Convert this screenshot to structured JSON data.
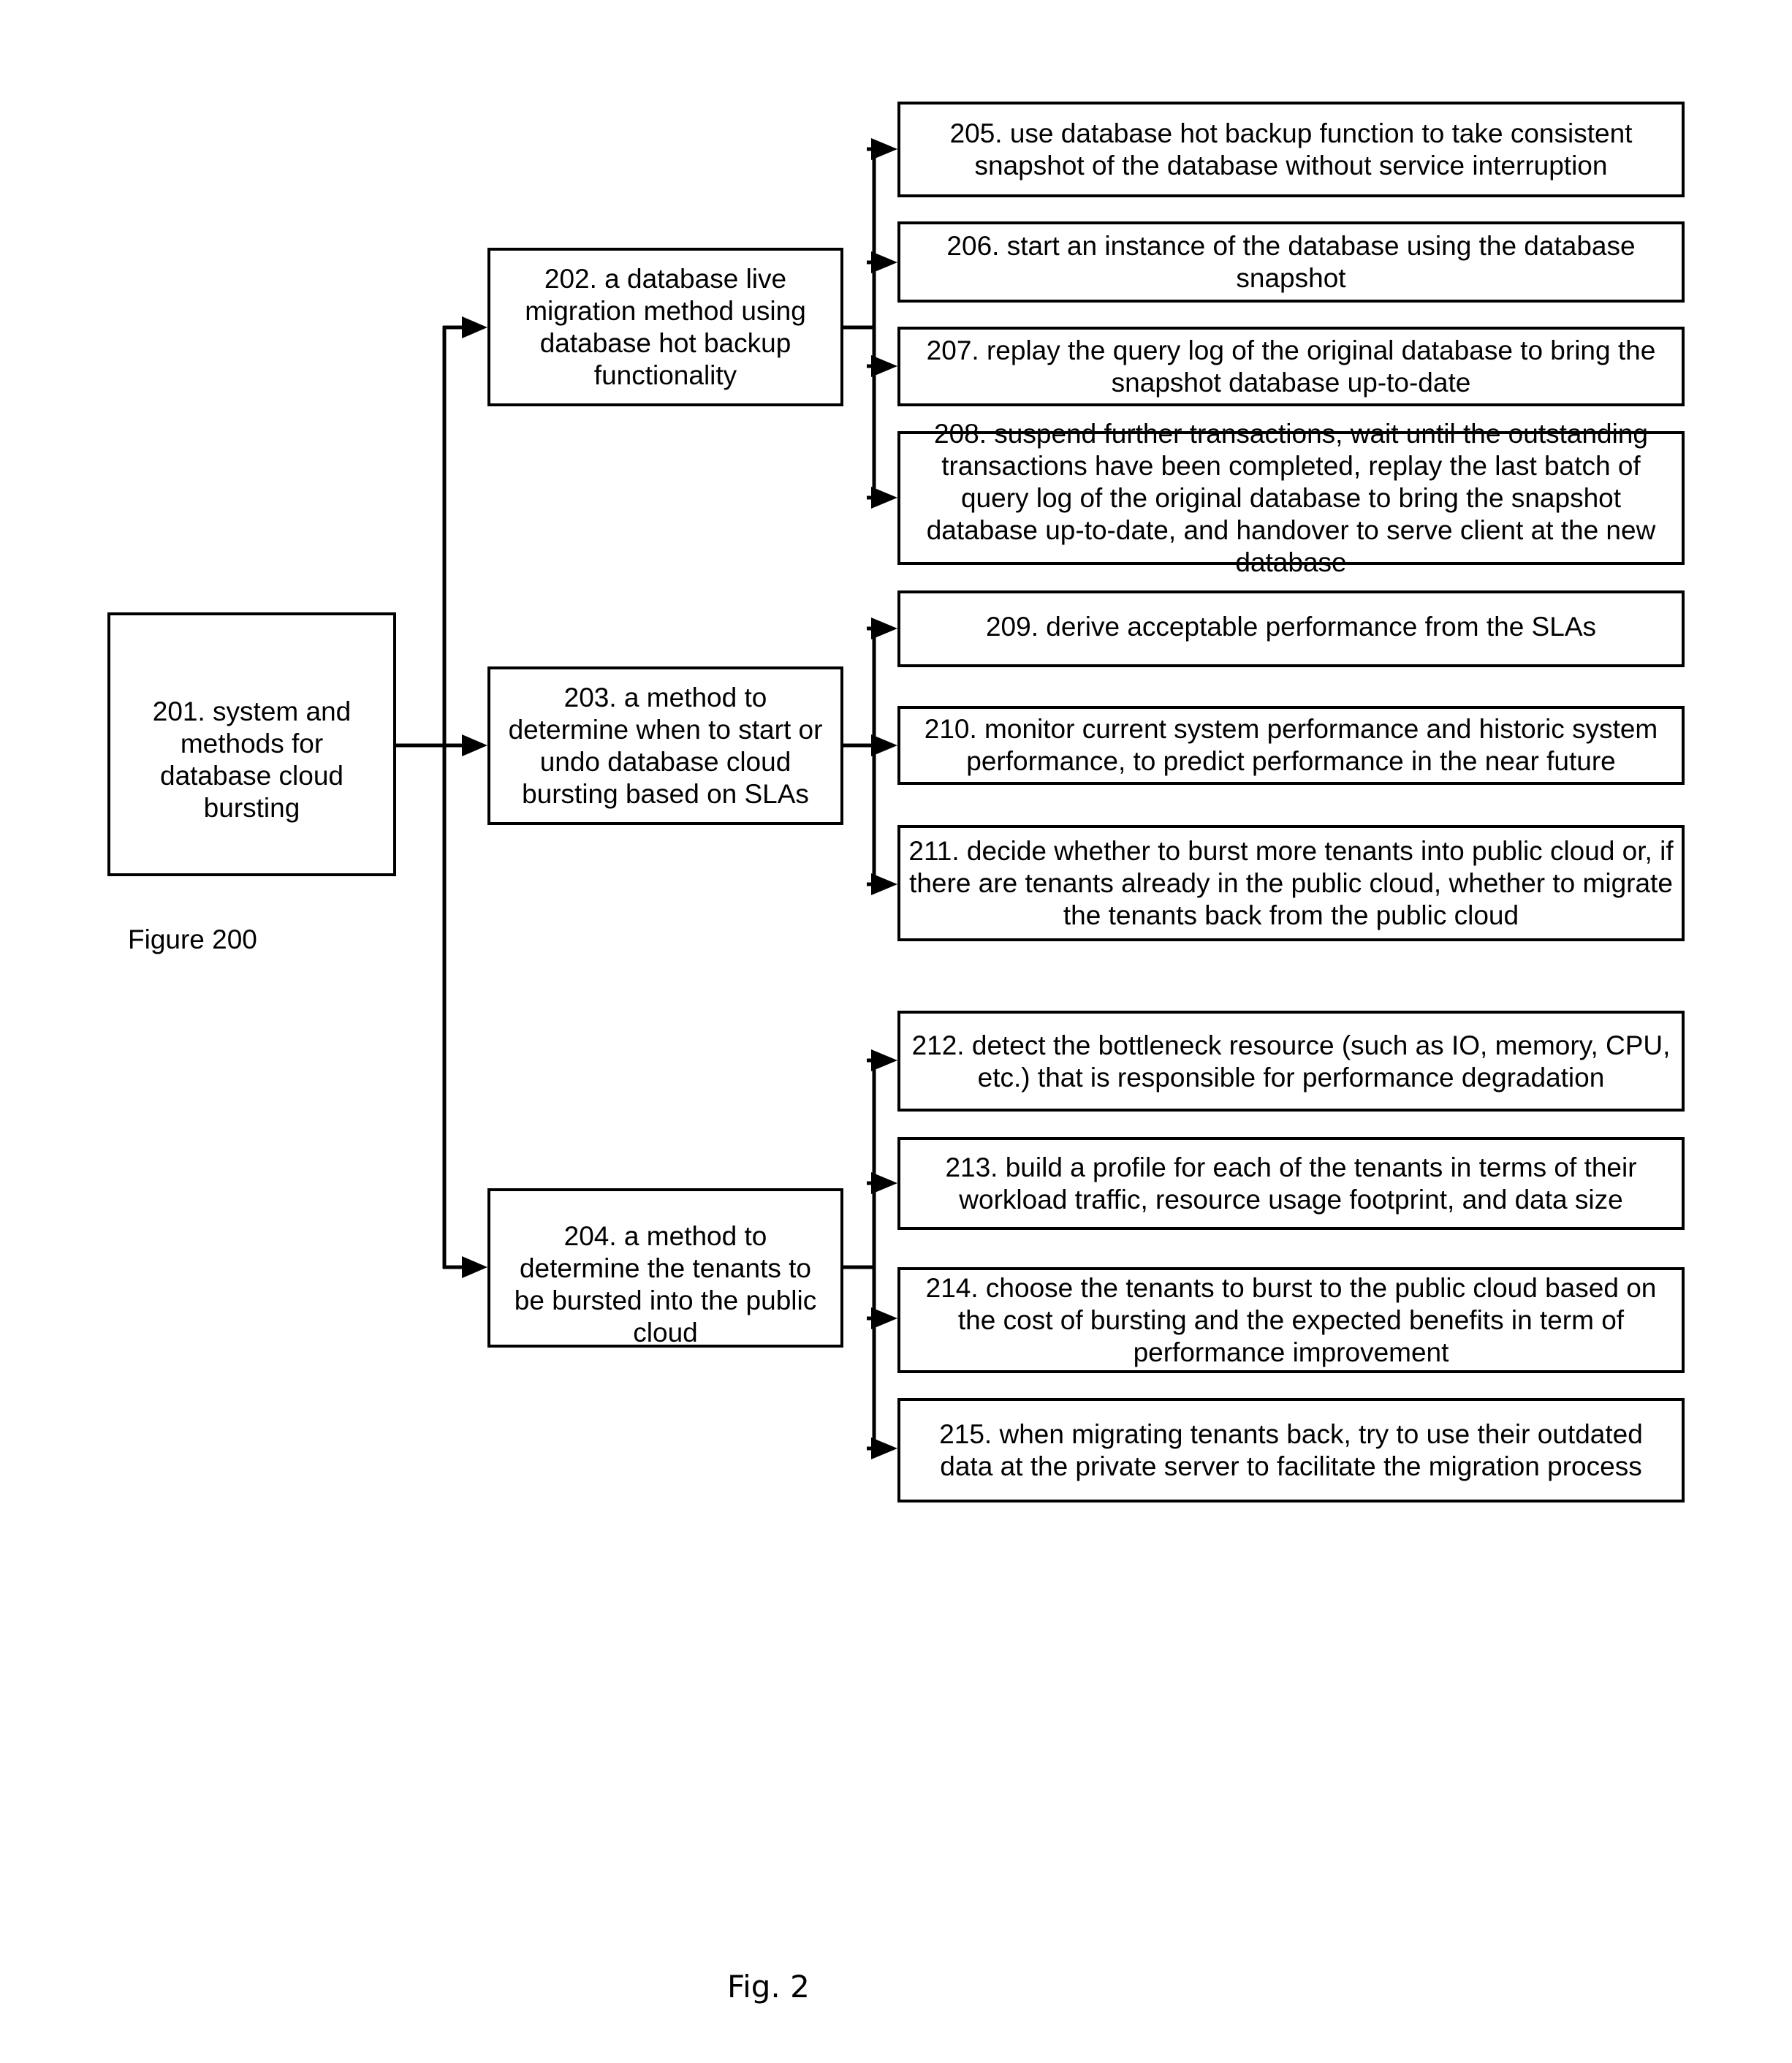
{
  "figure_label": "Figure 200",
  "figure_caption": "Fig. 2",
  "nodes": {
    "n201": "201. system and methods for database cloud bursting",
    "n202": "202. a database live migration method using database hot backup functionality",
    "n203": "203. a method to determine when to start or undo database cloud bursting based on SLAs",
    "n204": "204. a method to determine the tenants to be bursted into the public cloud",
    "n205": "205. use database hot backup function to take consistent snapshot of the database without service interruption",
    "n206": "206. start an instance of the database using the database snapshot",
    "n207": "207. replay the query log of the original database to bring the snapshot database up-to-date",
    "n208": "208. suspend further transactions, wait until the outstanding transactions have been completed, replay the last batch of query log of the original database to bring the snapshot database up-to-date, and handover to serve client at the new database",
    "n209": "209. derive acceptable performance from the SLAs",
    "n210": "210. monitor current system performance and historic system performance, to predict performance in the near future",
    "n211": "211. decide whether to burst more tenants into public cloud or, if there are tenants already in the public cloud, whether to migrate the tenants back from the public cloud",
    "n212": "212. detect the bottleneck resource (such as IO, memory, CPU, etc.) that is responsible for performance degradation",
    "n213": "213. build a profile for each of the tenants in terms of their workload traffic, resource usage footprint, and data size",
    "n214": "214. choose the tenants to burst to the public cloud based on the cost of bursting and the expected benefits in term of performance improvement",
    "n215": "215. when migrating tenants back, try to use their outdated data at the private server to facilitate the migration process"
  },
  "edges": [
    {
      "from": "n201",
      "to": "n202"
    },
    {
      "from": "n201",
      "to": "n203"
    },
    {
      "from": "n201",
      "to": "n204"
    },
    {
      "from": "n202",
      "to": "n205"
    },
    {
      "from": "n202",
      "to": "n206"
    },
    {
      "from": "n202",
      "to": "n207"
    },
    {
      "from": "n202",
      "to": "n208"
    },
    {
      "from": "n203",
      "to": "n209"
    },
    {
      "from": "n203",
      "to": "n210"
    },
    {
      "from": "n203",
      "to": "n211"
    },
    {
      "from": "n204",
      "to": "n212"
    },
    {
      "from": "n204",
      "to": "n213"
    },
    {
      "from": "n204",
      "to": "n214"
    },
    {
      "from": "n204",
      "to": "n215"
    }
  ]
}
